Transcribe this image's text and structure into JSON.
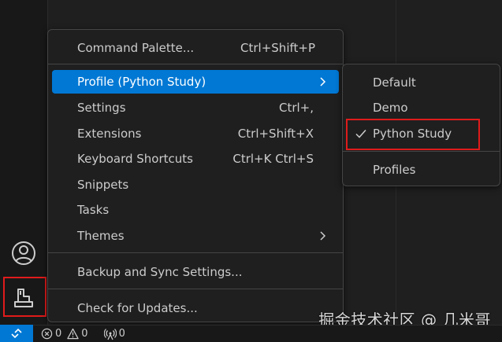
{
  "menu": {
    "items": [
      {
        "label": "Command Palette...",
        "shortcut": "Ctrl+Shift+P"
      },
      {
        "label": "Profile (Python Study)",
        "shortcut": ""
      },
      {
        "label": "Settings",
        "shortcut": "Ctrl+,"
      },
      {
        "label": "Extensions",
        "shortcut": "Ctrl+Shift+X"
      },
      {
        "label": "Keyboard Shortcuts",
        "shortcut": "Ctrl+K Ctrl+S"
      },
      {
        "label": "Snippets",
        "shortcut": ""
      },
      {
        "label": "Tasks",
        "shortcut": ""
      },
      {
        "label": "Themes",
        "shortcut": ""
      },
      {
        "label": "Backup and Sync Settings...",
        "shortcut": ""
      },
      {
        "label": "Check for Updates...",
        "shortcut": ""
      }
    ]
  },
  "submenu": {
    "items": [
      {
        "label": "Default"
      },
      {
        "label": "Demo"
      },
      {
        "label": "Python Study",
        "checked": true
      },
      {
        "label": "Profiles"
      }
    ]
  },
  "status": {
    "errors": "0",
    "warnings": "0",
    "ports": "0"
  },
  "watermark": "掘金技术社区 @ 几米哥",
  "colors": {
    "accent": "#0078d4",
    "highlight_border": "#e01b1b",
    "menu_bg": "#1f1f1f",
    "text": "#cccccc"
  },
  "icons": {
    "account": "account-icon",
    "manage": "manage-icon",
    "remote": "remote-icon",
    "error": "error-icon",
    "warning": "warning-icon",
    "ports": "ports-icon",
    "chevron": "chevron-right-icon",
    "check": "check-icon"
  }
}
